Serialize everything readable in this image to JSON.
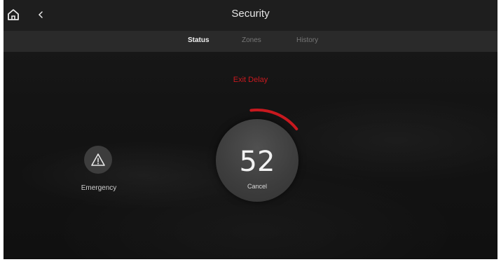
{
  "header": {
    "title": "Security",
    "home_icon": "home-icon",
    "back_icon": "chevron-left-icon"
  },
  "tabs": [
    {
      "label": "Status",
      "active": true
    },
    {
      "label": "Zones",
      "active": false
    },
    {
      "label": "History",
      "active": false
    }
  ],
  "status": {
    "state_text": "Exit Delay",
    "countdown": "52",
    "cancel_label": "Cancel",
    "progress_fraction": 0.12
  },
  "emergency": {
    "label": "Emergency",
    "icon": "warning-icon"
  },
  "colors": {
    "accent": "#c8191f",
    "background": "#141414",
    "topbar": "#1e1e1e",
    "tabbar": "#2a2a2a"
  }
}
